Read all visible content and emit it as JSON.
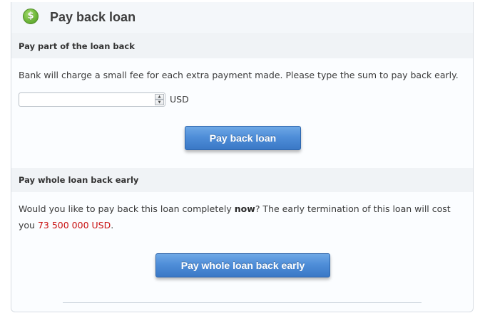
{
  "header": {
    "title": "Pay back loan",
    "icon": "dollar-coin-icon",
    "icon_glyph": "$"
  },
  "partial": {
    "heading": "Pay part of the loan back",
    "description": "Bank will charge a small fee for each extra payment made. Please type the sum to pay back early.",
    "amount_input": {
      "value": "",
      "placeholder": ""
    },
    "spin_up_glyph": "▲",
    "spin_down_glyph": "▼",
    "currency": "USD",
    "button_label": "Pay back loan"
  },
  "whole": {
    "heading": "Pay whole loan back early",
    "text_before": "Would you like to pay back this loan completely ",
    "text_bold": "now",
    "text_after": "? The early termination of this loan will cost you ",
    "amount": "73 500 000 USD",
    "text_end": ".",
    "button_label": "Pay whole loan back early"
  },
  "colors": {
    "accent_button": "#4f8ed8",
    "amount_text": "#c91010",
    "icon_green": "#6fb83a"
  }
}
